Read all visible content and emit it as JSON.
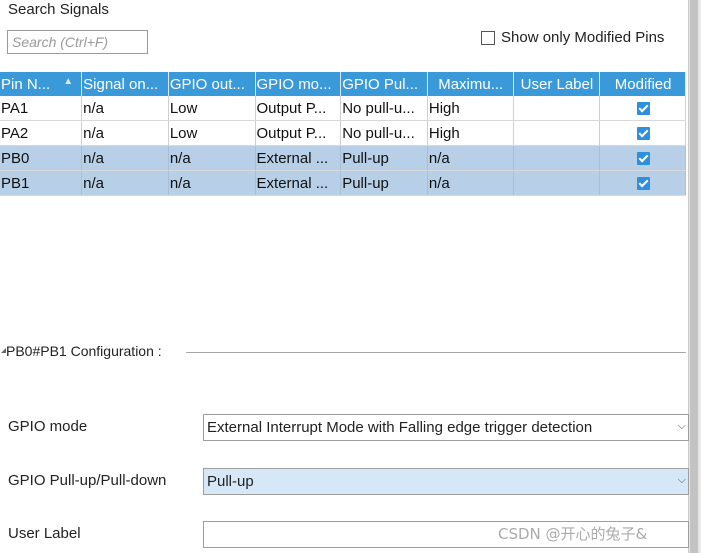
{
  "search": {
    "title": "Search Signals",
    "placeholder": "Search (Ctrl+F)",
    "show_modified_label": "Show only Modified Pins",
    "show_modified_checked": false
  },
  "table": {
    "columns": [
      "Pin N...",
      "Signal on...",
      "GPIO out...",
      "GPIO mo...",
      "GPIO Pul...",
      "Maximu...",
      "User Label",
      "Modified"
    ],
    "rows": [
      {
        "pin": "PA1",
        "signal": "n/a",
        "output": "Low",
        "mode": "Output P...",
        "pull": "No pull-u...",
        "max": "High",
        "label": "",
        "modified": true,
        "selected": false
      },
      {
        "pin": "PA2",
        "signal": "n/a",
        "output": "Low",
        "mode": "Output P...",
        "pull": "No pull-u...",
        "max": "High",
        "label": "",
        "modified": true,
        "selected": false
      },
      {
        "pin": "PB0",
        "signal": "n/a",
        "output": "n/a",
        "mode": "External ...",
        "pull": "Pull-up",
        "max": "n/a",
        "label": "",
        "modified": true,
        "selected": true
      },
      {
        "pin": "PB1",
        "signal": "n/a",
        "output": "n/a",
        "mode": "External ...",
        "pull": "Pull-up",
        "max": "n/a",
        "label": "",
        "modified": true,
        "selected": true
      }
    ]
  },
  "config": {
    "title": "PB0#PB1 Configuration :",
    "gpio_mode_label": "GPIO mode",
    "gpio_mode_value": "External Interrupt Mode with Falling edge trigger detection",
    "gpio_pull_label": "GPIO Pull-up/Pull-down",
    "gpio_pull_value": "Pull-up",
    "user_label_label": "User Label",
    "user_label_value": ""
  },
  "watermark": "CSDN @开心的兔子&",
  "icons": {
    "sort": "sort-ascending-icon",
    "dropdown": "chevron-down-icon",
    "check": "checkbox-checked-icon"
  },
  "colors": {
    "header_blue": "#3a9ad9",
    "selected_row": "#b8cfe8",
    "check_blue": "#2f8fdf"
  }
}
